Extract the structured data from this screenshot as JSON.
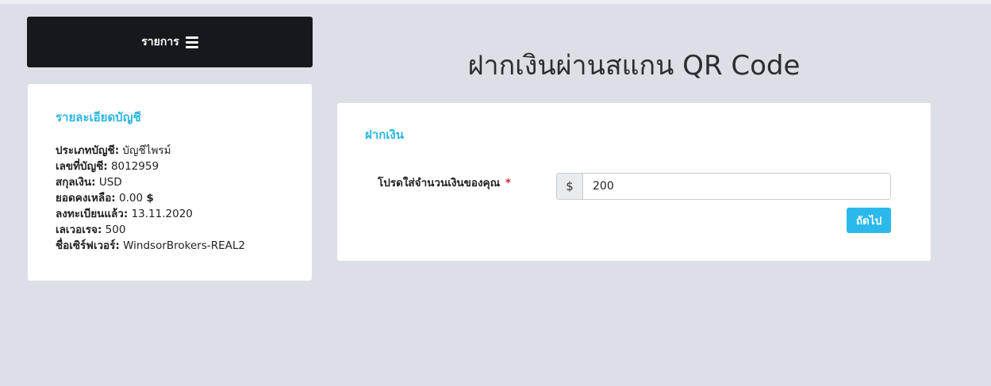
{
  "menu": {
    "label": "รายการ",
    "icon": "hamburger-menu-icon"
  },
  "page": {
    "title": "ฝากเงินผ่านสแกน QR Code"
  },
  "account": {
    "title": "รายละเอียดบัญชี",
    "rows": [
      {
        "label": "ประเภทบัญชี:",
        "value": " บัญชีไพรม์"
      },
      {
        "label": "เลขที่บัญชี:",
        "value": " 8012959"
      },
      {
        "label": "สกุลเงิน:",
        "value": " USD"
      },
      {
        "label": "ยอดคงเหลือ:",
        "value": " 0.00 ",
        "suffix": "$"
      },
      {
        "label": "ลงทะเบียนแล้ว:",
        "value": " 13.11.2020"
      },
      {
        "label": "เลเวอเรจ:",
        "value": " 500"
      },
      {
        "label": "ชื่อเซิร์ฟเวอร์:",
        "value": " WindsorBrokers-REAL2"
      }
    ]
  },
  "deposit": {
    "title": "ฝากเงิน",
    "amount_label": "โปรดใส่จำนวนเงินของคุณ",
    "required_mark": "*",
    "currency_symbol": "$",
    "amount_value": "200",
    "next_label": "ถัดไป"
  },
  "colors": {
    "accent": "#2bb5e0",
    "button": "#2bb9ec",
    "menu_bg": "#15181c",
    "page_bg": "#dcdfe6",
    "required": "#d9242c"
  }
}
